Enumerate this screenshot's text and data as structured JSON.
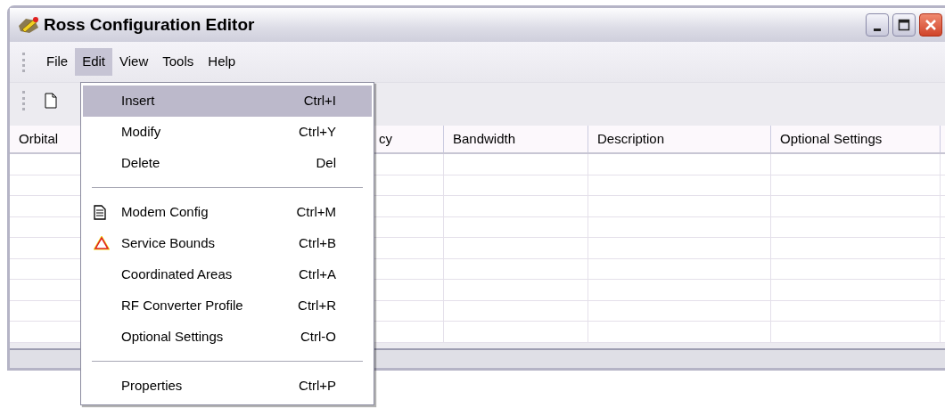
{
  "window": {
    "title": "Ross Configuration Editor"
  },
  "menubar": [
    {
      "label": "File",
      "selected": false
    },
    {
      "label": "Edit",
      "selected": true
    },
    {
      "label": "View",
      "selected": false
    },
    {
      "label": "Tools",
      "selected": false
    },
    {
      "label": "Help",
      "selected": false
    }
  ],
  "table": {
    "columns": [
      "Orbital",
      "cy",
      "Bandwidth",
      "Description",
      "Optional Settings"
    ]
  },
  "menu": {
    "items": [
      {
        "kind": "plain",
        "label": "Insert",
        "shortcut": "Ctrl+I",
        "selected": true
      },
      {
        "kind": "plain",
        "label": "Modify",
        "shortcut": "Ctrl+Y",
        "selected": false
      },
      {
        "kind": "plain",
        "label": "Delete",
        "shortcut": "Del",
        "selected": false
      },
      {
        "kind": "separator"
      },
      {
        "kind": "document",
        "label": "Modem Config",
        "shortcut": "Ctrl+M",
        "selected": false
      },
      {
        "kind": "warning",
        "label": "Service Bounds",
        "shortcut": "Ctrl+B",
        "selected": false
      },
      {
        "kind": "plain",
        "label": "Coordinated Areas",
        "shortcut": "Ctrl+A",
        "selected": false
      },
      {
        "kind": "plain",
        "label": "RF Converter Profile",
        "shortcut": "Ctrl+R",
        "selected": false
      },
      {
        "kind": "plain",
        "label": "Optional Settings",
        "shortcut": "Ctrl-O",
        "selected": false
      },
      {
        "kind": "separator"
      },
      {
        "kind": "plain",
        "label": "Properties",
        "shortcut": "Ctrl+P",
        "selected": false
      }
    ]
  }
}
